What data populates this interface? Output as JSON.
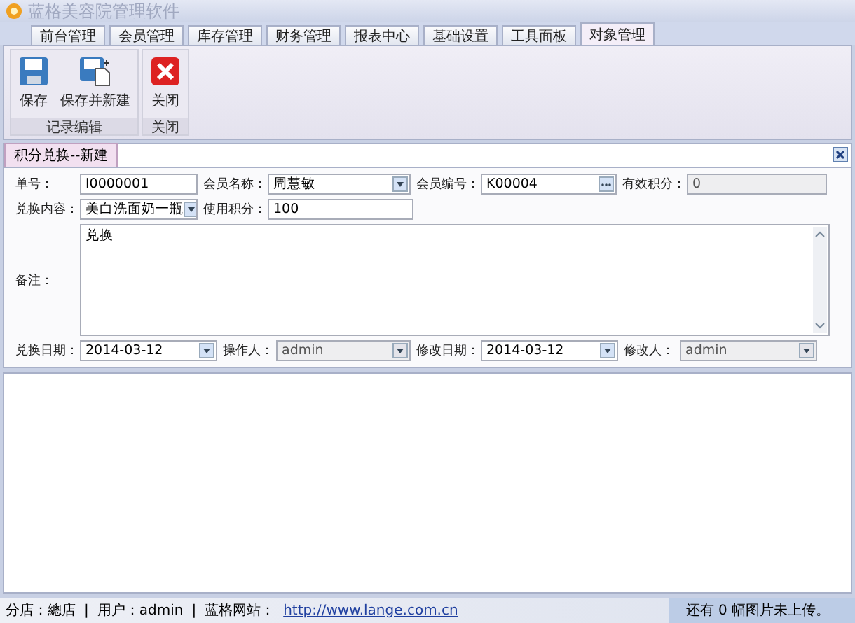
{
  "window": {
    "title": "蓝格美容院管理软件"
  },
  "tabs": [
    {
      "label": "前台管理",
      "selected": false
    },
    {
      "label": "会员管理",
      "selected": false
    },
    {
      "label": "库存管理",
      "selected": false
    },
    {
      "label": "财务管理",
      "selected": false
    },
    {
      "label": "报表中心",
      "selected": false
    },
    {
      "label": "基础设置",
      "selected": false
    },
    {
      "label": "工具面板",
      "selected": false
    },
    {
      "label": "对象管理",
      "selected": true
    }
  ],
  "ribbon_groups": [
    {
      "label": "记录编辑",
      "buttons": [
        {
          "label": "保存",
          "kind": "save"
        },
        {
          "label": "保存并新建",
          "kind": "save-new"
        }
      ]
    },
    {
      "label": "关闭",
      "buttons": [
        {
          "label": "关闭",
          "kind": "close"
        }
      ]
    }
  ],
  "document_tab": {
    "label": "积分兑换--新建"
  },
  "form_rows": [
    [
      {
        "label": "单号：",
        "value": "I0000001",
        "kind": "text",
        "disabled": false
      },
      {
        "label": "会员名称：",
        "value": "周慧敏",
        "kind": "combo",
        "disabled": false
      },
      {
        "label": "会员编号：",
        "value": "K00004",
        "kind": "lookup",
        "disabled": false
      },
      {
        "label": "有效积分：",
        "value": "0",
        "kind": "text",
        "disabled": true
      }
    ],
    [
      {
        "label": "兑换内容：",
        "value": "美白洗面奶一瓶",
        "kind": "combo",
        "disabled": false
      },
      {
        "label": "使用积分：",
        "value": "100",
        "kind": "text",
        "disabled": false
      }
    ],
    [
      {
        "label": "备注：",
        "value": "兑换",
        "kind": "memo",
        "disabled": false
      }
    ],
    [
      {
        "label": "兑换日期：",
        "value": "2014-03-12",
        "kind": "combo",
        "disabled": false
      },
      {
        "label": "操作人：",
        "value": "admin",
        "kind": "combo",
        "disabled": true
      },
      {
        "label": "修改日期：",
        "value": "2014-03-12",
        "kind": "combo",
        "disabled": false
      },
      {
        "label": "修改人：",
        "value": "admin",
        "kind": "combo",
        "disabled": true
      }
    ]
  ],
  "status_bar": {
    "branch": "分店：總店",
    "separator_1": "|",
    "user": "用户：admin",
    "separator_2": "|",
    "site_label": "蓝格网站：",
    "site_link": "http://www.lange.com.cn",
    "upload_status": "还有 0 幅图片未上传。"
  }
}
